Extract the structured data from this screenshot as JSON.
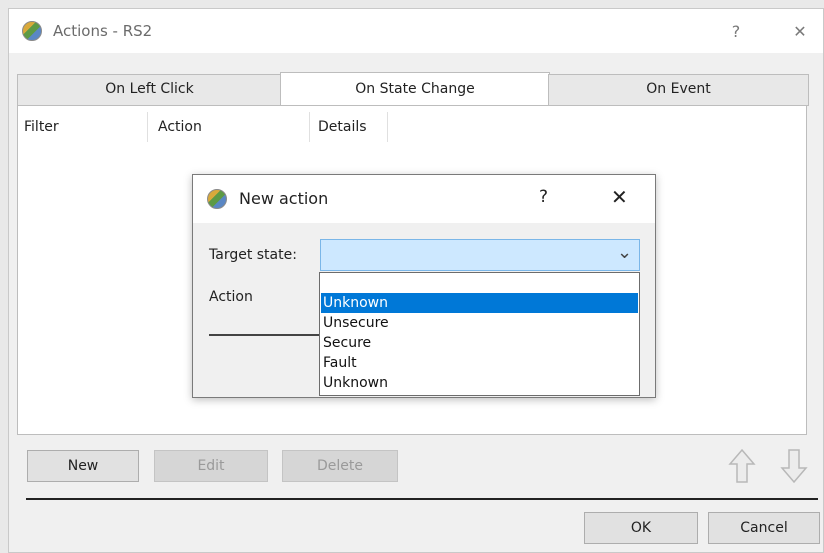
{
  "window": {
    "title": "Actions - RS2",
    "help_glyph": "?",
    "close_glyph": "✕"
  },
  "tabs": [
    {
      "label": "On Left Click",
      "active": false
    },
    {
      "label": "On State Change",
      "active": true
    },
    {
      "label": "On Event",
      "active": false
    }
  ],
  "table": {
    "columns": [
      "Filter",
      "Action",
      "Details"
    ]
  },
  "buttons": {
    "new": "New",
    "edit": "Edit",
    "delete": "Delete",
    "ok": "OK",
    "cancel": "Cancel"
  },
  "dialog": {
    "title": "New action",
    "help_glyph": "?",
    "close_glyph": "✕",
    "target_state_label": "Target state:",
    "target_state_value": "",
    "action_label": "Action",
    "dropdown_glyph": "⌄",
    "options": [
      "",
      "Unknown",
      "Unsecure",
      "Secure",
      "Fault",
      "Unknown"
    ],
    "selected_option_index": 1
  },
  "icons": {
    "app": "app-logo-icon",
    "move_up": "arrow-up-icon",
    "move_down": "arrow-down-icon"
  },
  "colors": {
    "selection": "#0078d7",
    "combo_focus": "#cde8ff"
  }
}
